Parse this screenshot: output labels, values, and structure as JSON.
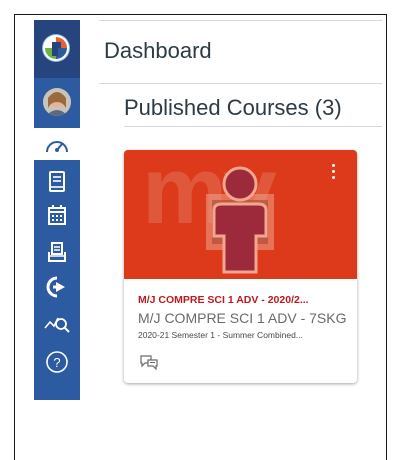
{
  "header": {
    "title": "Dashboard",
    "subtitle": "Published Courses (3)"
  },
  "sidebar": {
    "items": [
      {
        "name": "logo",
        "icon": "canvas-logo-icon"
      },
      {
        "name": "account",
        "icon": "avatar"
      },
      {
        "name": "dashboard",
        "icon": "speedometer-icon"
      },
      {
        "name": "courses",
        "icon": "book-icon"
      },
      {
        "name": "calendar",
        "icon": "calendar-icon"
      },
      {
        "name": "inbox",
        "icon": "inbox-icon"
      },
      {
        "name": "commons",
        "icon": "commons-arrow-icon"
      },
      {
        "name": "studio",
        "icon": "studio-icon"
      },
      {
        "name": "help",
        "icon": "help-icon"
      }
    ]
  },
  "course_card": {
    "hero_color": "#dd3a1c",
    "watermark": "my",
    "code": "M/J COMPRE SCI 1 ADV - 2020/2...",
    "name": "M/J COMPRE SCI 1 ADV - 7SKG",
    "term": "2020-21 Semester 1 - Summer Combined...",
    "action_icon": "discussions-icon",
    "options_icon": "kebab-menu-icon"
  },
  "colors": {
    "sidebar": "#2d5ba1",
    "sidebar_logo_bg": "#26457e",
    "course_code": "#c0181f",
    "text": "#2d3b45"
  }
}
